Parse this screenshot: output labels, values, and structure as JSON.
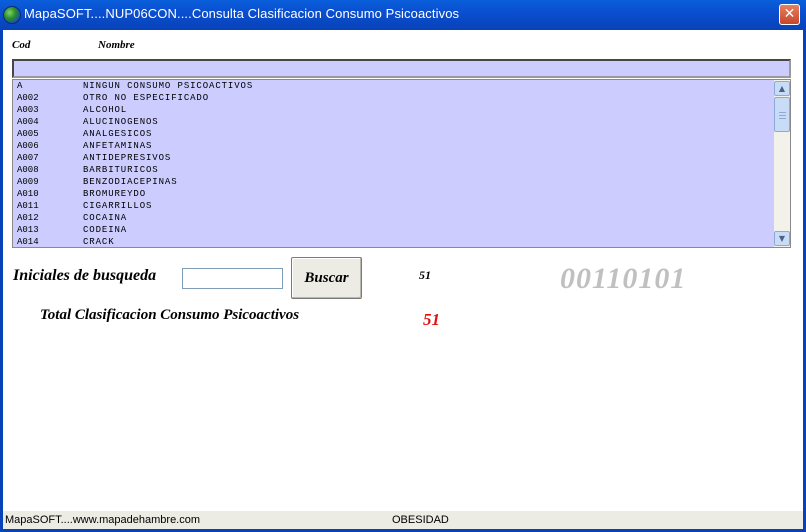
{
  "window": {
    "title": "MapaSOFT....NUP06CON....Consulta  Clasificacion Consumo Psicoactivos",
    "close_symbol": "✕"
  },
  "columns": {
    "cod": "Cod",
    "nombre": "Nombre"
  },
  "filter": {
    "value": ""
  },
  "list": {
    "items": [
      {
        "code": "A",
        "name": "NINGUN CONSUMO PSICOACTIVOS"
      },
      {
        "code": "A002",
        "name": "OTRO NO ESPECIFICADO"
      },
      {
        "code": "A003",
        "name": "ALCOHOL"
      },
      {
        "code": "A004",
        "name": "ALUCINOGENOS"
      },
      {
        "code": "A005",
        "name": "ANALGESICOS"
      },
      {
        "code": "A006",
        "name": "ANFETAMINAS"
      },
      {
        "code": "A007",
        "name": "ANTIDEPRESIVOS"
      },
      {
        "code": "A008",
        "name": "BARBITURICOS"
      },
      {
        "code": "A009",
        "name": "BENZODIACEPINAS"
      },
      {
        "code": "A010",
        "name": "BROMUREYDO"
      },
      {
        "code": "A011",
        "name": "CIGARRILLOS"
      },
      {
        "code": "A012",
        "name": "COCAINA"
      },
      {
        "code": "A013",
        "name": "CODEINA"
      },
      {
        "code": "A014",
        "name": "CRACK"
      }
    ]
  },
  "scroll": {
    "up_icon": "arrow-up",
    "down_icon": "arrow-down",
    "up_glyph": "▲",
    "down_glyph": "▼"
  },
  "search": {
    "label": "Iniciales de busqueda",
    "input_value": "",
    "button_label": "Buscar",
    "count": "51"
  },
  "code_display": "00110101",
  "total": {
    "label": "Total  Clasificacion Consumo Psicoactivos",
    "value": "51",
    "value_color": "#e01010"
  },
  "status": {
    "left": "MapaSOFT....www.mapadehambre.com",
    "middle": "OBESIDAD"
  },
  "colors": {
    "list_bg": "#ccccff",
    "title_bar": "#0a4fd0",
    "code_display": "#c0c0c0"
  }
}
